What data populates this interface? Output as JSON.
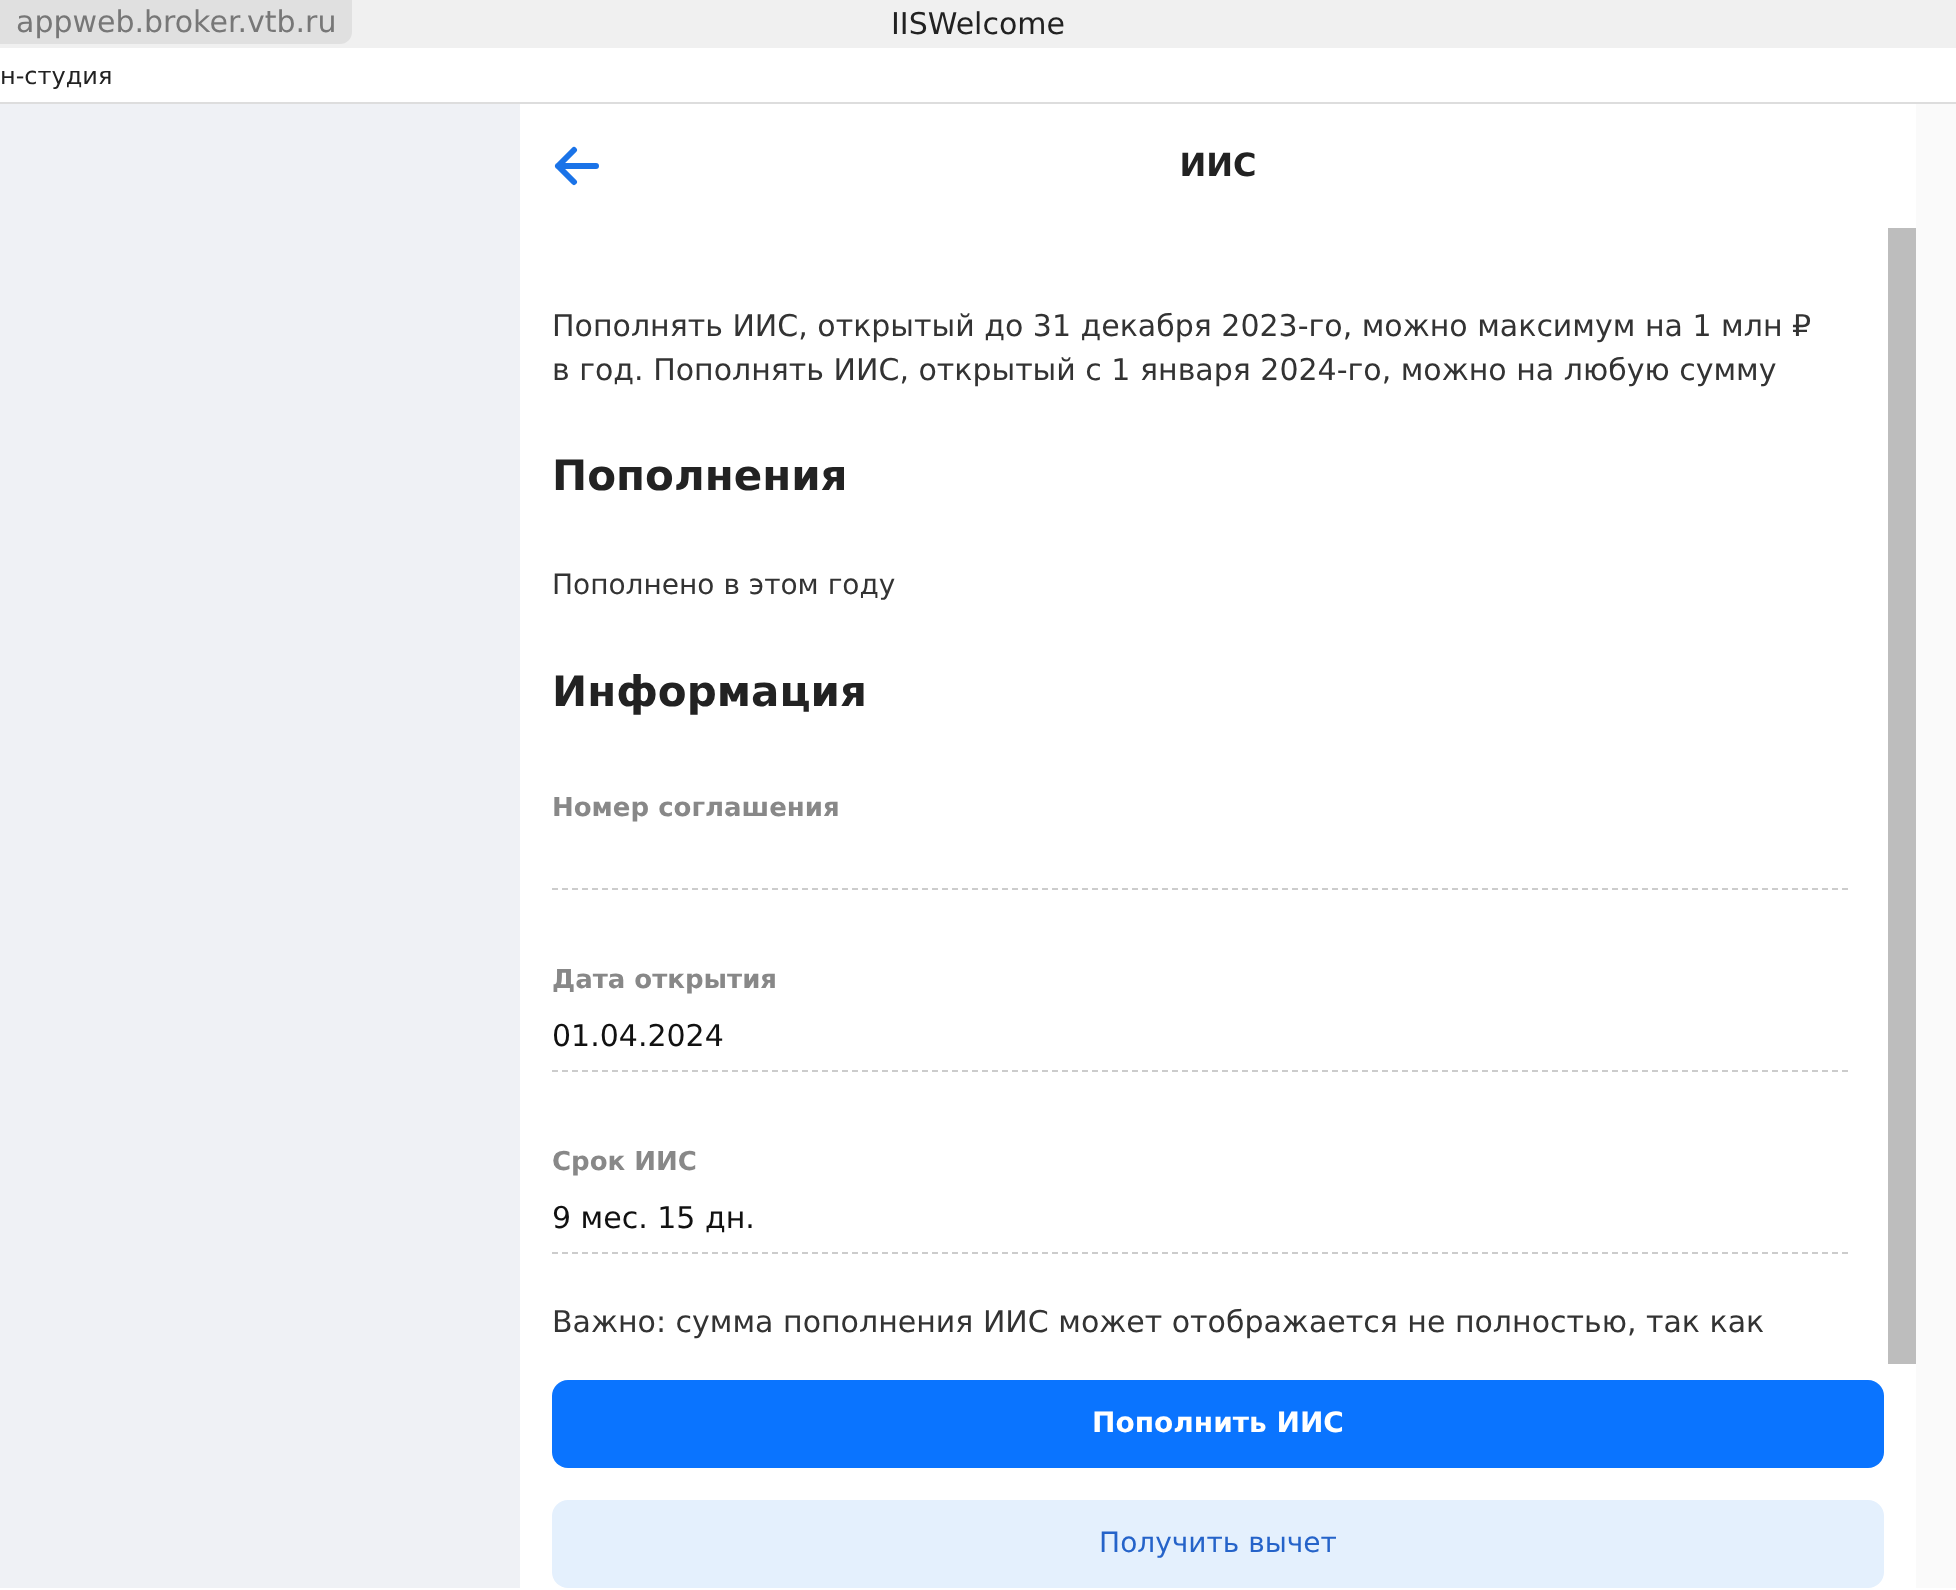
{
  "browser": {
    "address": "appweb.broker.vtb.ru",
    "title": "IISWelcome",
    "bookmark": "н-студия"
  },
  "header": {
    "title": "ИИС"
  },
  "intro": "Пополнять ИИС, открытый до 31 декабря 2023-го, можно максимум на 1 млн ₽ в год. Пополнять ИИС, открытый с 1 января 2024-го, можно на любую сумму",
  "sections": [
    {
      "title": "Пополнения",
      "rows": [
        {
          "kind": "plain",
          "label": "Пополнено в этом году"
        }
      ]
    },
    {
      "title": "Информация",
      "rows": [
        {
          "kind": "field",
          "label": "Номер соглашения"
        },
        {
          "kind": "field",
          "label": "Дата открытия",
          "value": "01.04.2024"
        },
        {
          "kind": "field",
          "label": "Срок ИИС",
          "value": "9 мес. 15 дн."
        }
      ]
    }
  ],
  "note": "Важно: сумма пополнения ИИС может отображается не полностью, так как",
  "buttons": [
    {
      "kind": "primary",
      "label": "Пополнить ИИС"
    },
    {
      "kind": "secondary",
      "label": "Получить вычет"
    }
  ]
}
